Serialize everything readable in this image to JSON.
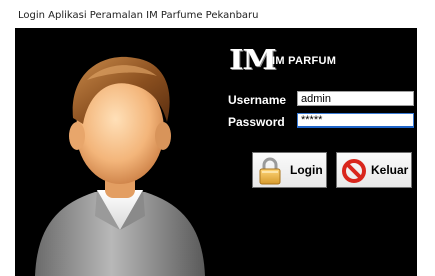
{
  "window": {
    "title": "Login Aplikasi Peramalan IM Parfume Pekanbaru"
  },
  "brand": {
    "logo_mark": "IM",
    "logo_text": "IM PARFUM"
  },
  "form": {
    "username_label": "Username",
    "username_value": "admin",
    "password_label": "Password",
    "password_value": "*****"
  },
  "buttons": {
    "login_label": "Login",
    "login_icon": "padlock-icon",
    "keluar_label": "Keluar",
    "keluar_icon": "prohibited-icon"
  },
  "colors": {
    "form_background": "#000000",
    "label_text": "#ffffff",
    "keluar_icon_red": "#d9261c",
    "padlock_gold": "#e8b44a"
  }
}
